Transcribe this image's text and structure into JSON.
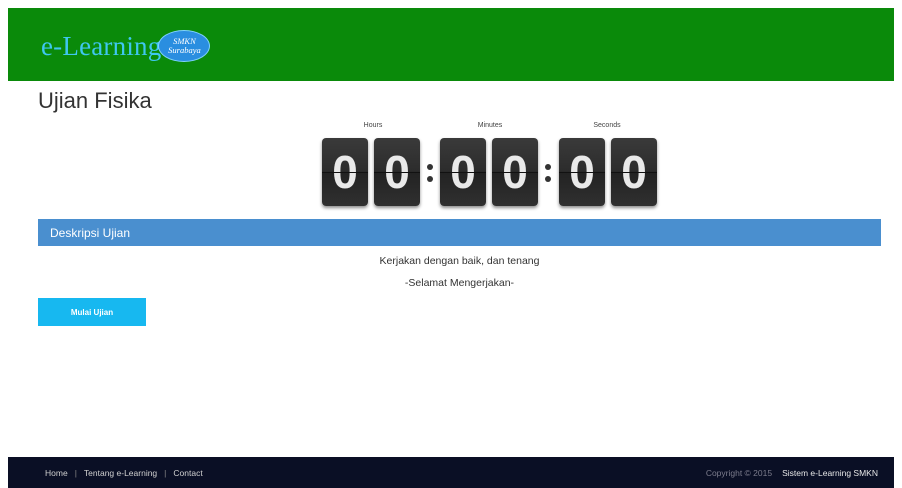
{
  "header": {
    "brand": "e-Learning",
    "badge_line1": "SMKN",
    "badge_line2": "Surabaya",
    "bg_color": "#0a8a0a"
  },
  "page_title": "Ujian Fisika",
  "countdown": {
    "labels": {
      "hours": "Hours",
      "minutes": "Minutes",
      "seconds": "Seconds"
    },
    "digits": [
      "0",
      "0",
      "0",
      "0",
      "0",
      "0"
    ]
  },
  "description": {
    "heading": "Deskripsi Ujian",
    "line1": "Kerjakan dengan baik, dan tenang",
    "line2": "-Selamat Mengerjakan-"
  },
  "start_button": {
    "label": "Mulai Ujian"
  },
  "footer": {
    "links": [
      "Home",
      "Tentang e-Learning",
      "Contact"
    ],
    "separator": "|",
    "copyright": "Copyright © 2015",
    "system_name": "Sistem e-Learning SMKN"
  },
  "colors": {
    "header": "#0a8a0a",
    "desc_bar": "#4a8fcf",
    "button": "#17b8f0",
    "footer": "#0a0f25"
  }
}
